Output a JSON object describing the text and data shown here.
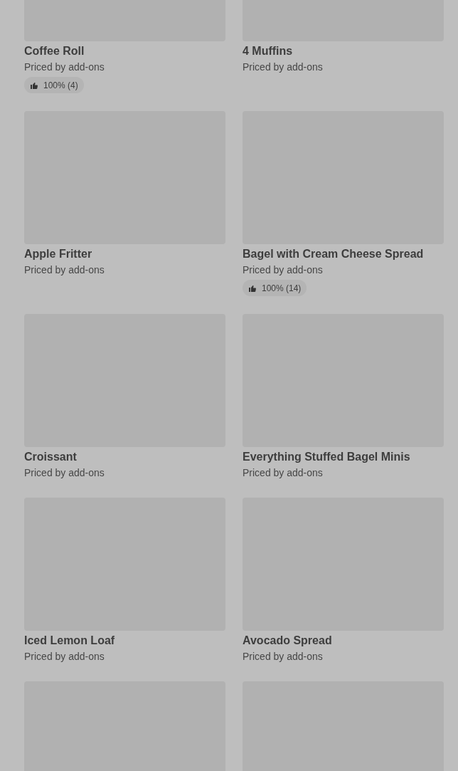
{
  "items": [
    {
      "kind": "product",
      "title": "Coffee Roll",
      "subtitle": "Priced by add-ons",
      "rating": "100% (4)"
    },
    {
      "kind": "product",
      "title": "4 Muffins",
      "subtitle": "Priced by add-ons"
    },
    {
      "kind": "product",
      "title": "Apple Fritter",
      "subtitle": "Priced by add-ons"
    },
    {
      "kind": "product",
      "title": "Bagel with Cream Cheese Spread",
      "subtitle": "Priced by add-ons",
      "rating": "100% (14)"
    },
    {
      "kind": "product",
      "title": "Croissant",
      "subtitle": "Priced by add-ons"
    },
    {
      "kind": "product",
      "title": "Everything Stuffed Bagel Minis",
      "subtitle": "Priced by add-ons"
    },
    {
      "kind": "product",
      "title": "Iced Lemon Loaf",
      "subtitle": "Priced by add-ons"
    },
    {
      "kind": "product",
      "title": "Avocado Spread",
      "subtitle": "Priced by add-ons"
    },
    {
      "kind": "image-only"
    },
    {
      "kind": "image-only"
    }
  ]
}
